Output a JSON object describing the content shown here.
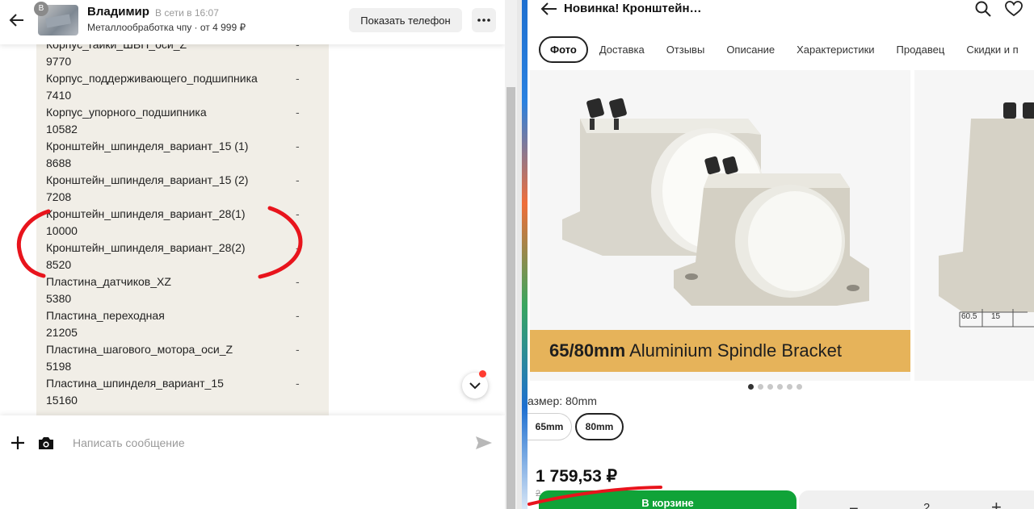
{
  "chat": {
    "header": {
      "avatar_letter": "В",
      "name": "Владимир",
      "status": "В сети в 16:07",
      "subtitle": "Металлообработка чпу · от 4 999 ₽",
      "show_phone_label": "Показать телефон"
    },
    "message_items": [
      {
        "text": "Корпус_гайки_ШВП_оси_Z",
        "dash": "-"
      },
      {
        "text": "9770",
        "dash": ""
      },
      {
        "text": "Корпус_поддерживающего_подшипника",
        "dash": "-"
      },
      {
        "text": "7410",
        "dash": ""
      },
      {
        "text": "Корпус_упорного_подшипника",
        "dash": "-"
      },
      {
        "text": "10582",
        "dash": ""
      },
      {
        "text": "Кронштейн_шпинделя_вариант_15 (1)",
        "dash": "-"
      },
      {
        "text": "8688",
        "dash": ""
      },
      {
        "text": "Кронштейн_шпинделя_вариант_15 (2)",
        "dash": "-"
      },
      {
        "text": "7208",
        "dash": ""
      },
      {
        "text": "Кронштейн_шпинделя_вариант_28(1)",
        "dash": "-"
      },
      {
        "text": "10000",
        "dash": ""
      },
      {
        "text": "Кронштейн_шпинделя_вариант_28(2)",
        "dash": "-"
      },
      {
        "text": "8520",
        "dash": ""
      },
      {
        "text": "Пластина_датчиков_XZ",
        "dash": "-"
      },
      {
        "text": "5380",
        "dash": ""
      },
      {
        "text": "Пластина_переходная",
        "dash": "-"
      },
      {
        "text": "21205",
        "dash": ""
      },
      {
        "text": "Пластина_шагового_мотора_оси_Z",
        "dash": "-"
      },
      {
        "text": "5198",
        "dash": ""
      },
      {
        "text": "Пластина_шпинделя_вариант_15",
        "dash": "-"
      },
      {
        "text": "15160",
        "dash": ""
      }
    ],
    "composer": {
      "placeholder": "Написать сообщение"
    },
    "icons": [
      "arrow-left-icon",
      "more-icon",
      "chevron-down-icon",
      "plus-icon",
      "camera-icon",
      "send-icon"
    ]
  },
  "product": {
    "title": "Новинка! Кронштейн…",
    "tabs": [
      "Фото",
      "Доставка",
      "Отзывы",
      "Описание",
      "Характеристики",
      "Продавец",
      "Скидки и п"
    ],
    "active_tab": "Фото",
    "image_caption_bold": "65/80mm",
    "image_caption_rest": " Aluminium Spindle Bracket",
    "dimension_labels": [
      "60.5",
      "15"
    ],
    "gallery_dots": 6,
    "gallery_active_dot": 1,
    "size_label": "азмер: 80mm",
    "size_options": [
      "65mm",
      "80mm"
    ],
    "selected_size": "80mm",
    "price": "1 759,53 ₽",
    "old_price": "2",
    "cart_label": "В корзине",
    "qty_minus": "−",
    "qty_value": "2",
    "qty_plus": "+",
    "icons": [
      "arrow-left-icon",
      "search-icon",
      "heart-icon"
    ]
  },
  "colors": {
    "annotation": "#e8141c",
    "cart_green": "#10a338",
    "bubble": "#f1eee7",
    "caption_bar": "#e6b35a"
  }
}
